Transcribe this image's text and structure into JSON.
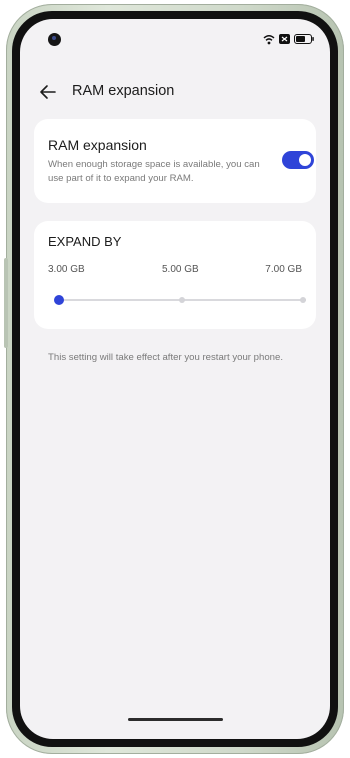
{
  "header": {
    "title": "RAM expansion"
  },
  "ram_card": {
    "title": "RAM expansion",
    "description": "When enough storage space is available, you can use part of it to expand your RAM.",
    "toggle_on": true
  },
  "expand_card": {
    "title": "EXPAND BY",
    "options": [
      "3.00 GB",
      "5.00 GB",
      "7.00 GB"
    ],
    "selected": "3.00 GB"
  },
  "note": "This setting will take effect after you restart your phone.",
  "colors": {
    "accent": "#2f44d8",
    "background": "#f3f2f4",
    "card": "#ffffff"
  },
  "icons": {
    "back": "arrow-left-icon",
    "wifi": "wifi-icon",
    "notification": "notification-icon",
    "battery": "battery-icon"
  }
}
